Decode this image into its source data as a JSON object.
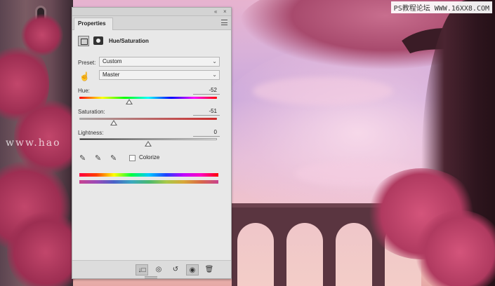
{
  "watermarks": {
    "top_right": "PS教程论坛 WWW.16XX8.COM",
    "left": "www.hao"
  },
  "panel": {
    "collapse_glyph": "«",
    "close_glyph": "×",
    "tab_label": "Properties",
    "adjustment_title": "Hue/Saturation",
    "preset_label": "Preset:",
    "preset_value": "Custom",
    "channel_value": "Master",
    "hue": {
      "label": "Hue:",
      "value": "-52",
      "position": 0.36
    },
    "saturation": {
      "label": "Saturation:",
      "value": "-51",
      "position": 0.25
    },
    "lightness": {
      "label": "Lightness:",
      "value": "0",
      "position": 0.5
    },
    "colorize_label": "Colorize",
    "colorize_checked": false
  },
  "icons": {
    "adjustment": "hue-saturation-icon",
    "mask": "mask-icon",
    "targeted_adjust": "hand-icon",
    "eyedroppers": [
      "eyedropper-icon",
      "eyedropper-plus-icon",
      "eyedropper-minus-icon"
    ],
    "bottom_bar": [
      "clip-to-layer-icon",
      "view-previous-icon",
      "reset-icon",
      "visibility-eye-icon",
      "trash-icon"
    ]
  },
  "glyphs": {
    "chevron": "⌄",
    "hand": "☝",
    "eyedropper": "✎",
    "clip": "↓□",
    "view_previous": "◎",
    "reset": "↺",
    "eye": "◉",
    "trash": "🗑"
  },
  "colors": {
    "panel_bg": "#e8e8e8",
    "accent_red": "#cc2a2a"
  }
}
